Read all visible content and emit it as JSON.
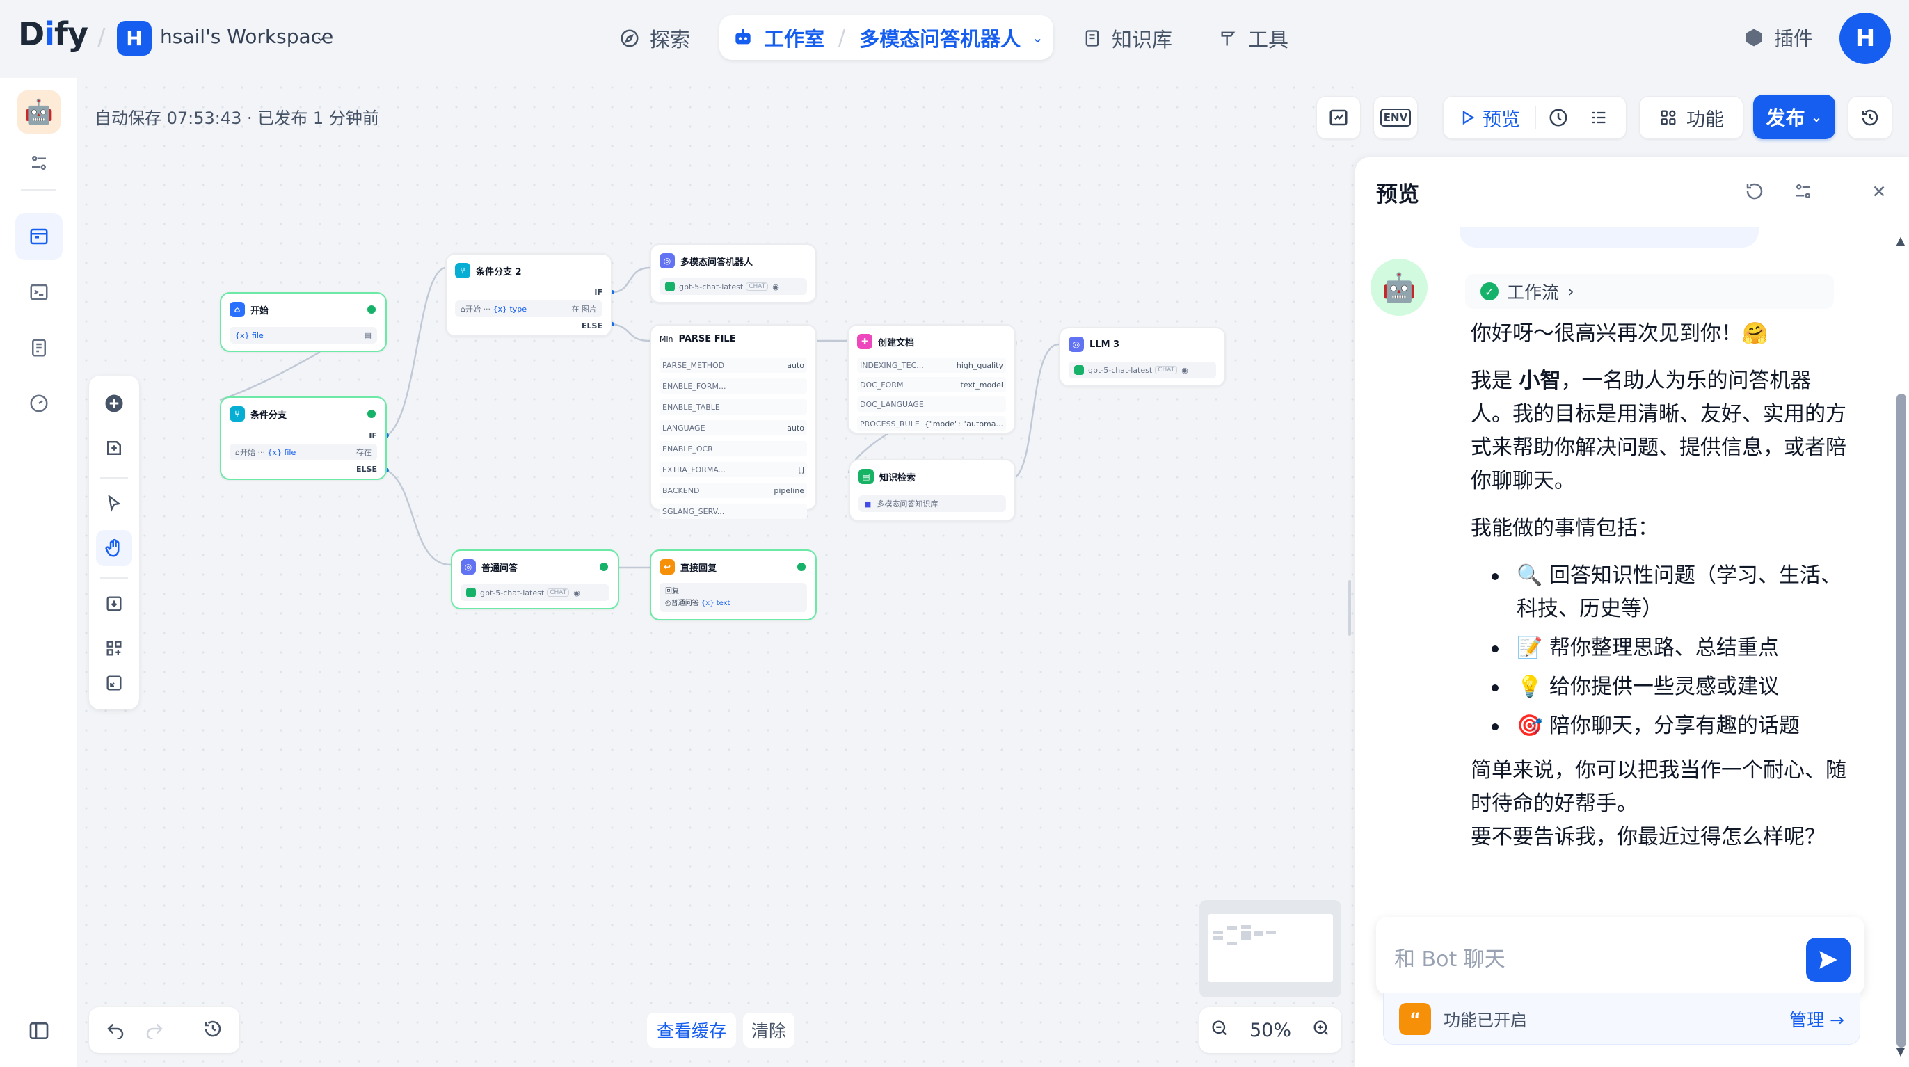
{
  "brand": {
    "logo_prefix": "D",
    "logo_accent": "i",
    "logo_suffix": "fy"
  },
  "workspace": {
    "initial": "H",
    "name": "hsail's Workspace"
  },
  "nav": {
    "explore": "探索",
    "studio": "工作室",
    "app_name": "多模态问答机器人",
    "knowledge": "知识库",
    "tools": "工具",
    "plugins": "插件",
    "user_initial": "H"
  },
  "status": {
    "autosave": "自动保存 07:53:43 · 已发布 1 分钟前"
  },
  "toolbar": {
    "env_label": "ENV",
    "preview_label": "预览",
    "features_label": "功能",
    "publish_label": "发布"
  },
  "canvas": {
    "cache_label": "查看缓存",
    "clear_label": "清除",
    "zoom": "50%"
  },
  "nodes": {
    "start": {
      "title": "开始",
      "var": "{x} file"
    },
    "branch1": {
      "title": "条件分支",
      "if": "IF",
      "else": "ELSE",
      "cond_left": "开始",
      "cond_var": "{x} file",
      "cond_op": "存在"
    },
    "branch2": {
      "title": "条件分支 2",
      "if": "IF",
      "else": "ELSE",
      "cond_left": "开始",
      "cond_var": "{x} type",
      "cond_op": "在 图片"
    },
    "mm_bot": {
      "title": "多模态问答机器人",
      "model": "gpt-5-chat-latest",
      "chip": "CHAT"
    },
    "parse": {
      "title": "PARSE FILE",
      "prefix": "Min",
      "rows": [
        {
          "k": "PARSE_METHOD",
          "v": "auto"
        },
        {
          "k": "ENABLE_FORM...",
          "v": ""
        },
        {
          "k": "ENABLE_TABLE",
          "v": ""
        },
        {
          "k": "LANGUAGE",
          "v": "auto"
        },
        {
          "k": "ENABLE_OCR",
          "v": ""
        },
        {
          "k": "EXTRA_FORMA...",
          "v": "[]"
        },
        {
          "k": "BACKEND",
          "v": "pipeline"
        },
        {
          "k": "SGLANG_SERV...",
          "v": ""
        }
      ]
    },
    "create_doc": {
      "title": "创建文档",
      "rows": [
        {
          "k": "INDEXING_TEC...",
          "v": "high_quality"
        },
        {
          "k": "DOC_FORM",
          "v": "text_model"
        },
        {
          "k": "DOC_LANGUAGE",
          "v": ""
        },
        {
          "k": "PROCESS_RULE",
          "v": "{\"mode\": \"automa..."
        }
      ]
    },
    "llm3": {
      "title": "LLM 3",
      "model": "gpt-5-chat-latest",
      "chip": "CHAT"
    },
    "retrieval": {
      "title": "知识检索",
      "kb": "多模态问答知识库"
    },
    "normal_qa": {
      "title": "普通问答",
      "model": "gpt-5-chat-latest",
      "chip": "CHAT"
    },
    "direct_reply": {
      "title": "直接回复",
      "label": "回复",
      "src": "普通问答",
      "var": "{x} text"
    }
  },
  "preview": {
    "title": "预览",
    "workflow_chip": "工作流",
    "greeting": "你好呀～很高兴再次见到你！🤗",
    "intro_pre": "我是 ",
    "intro_name": "小智",
    "intro_post": "，一名助人为乐的问答机器人。我的目标是用清晰、友好、实用的方式来帮助你解决问题、提供信息，或者陪你聊聊天。",
    "can_do": "我能做的事情包括：",
    "items": [
      "🔍 回答知识性问题（学习、生活、科技、历史等）",
      "📝 帮你整理思路、总结重点",
      "💡 给你提供一些灵感或建议",
      "🎯 陪你聊天，分享有趣的话题"
    ],
    "summary": "简单来说，你可以把我当作一个耐心、随时待命的好帮手。",
    "question": "要不要告诉我，你最近过得怎么样呢？",
    "input_placeholder": "和 Bot 聊天",
    "feature_enabled": "功能已开启",
    "manage": "管理 →"
  },
  "colors": {
    "accent": "#155eef",
    "success": "#17b26a",
    "warning": "#f79009"
  }
}
